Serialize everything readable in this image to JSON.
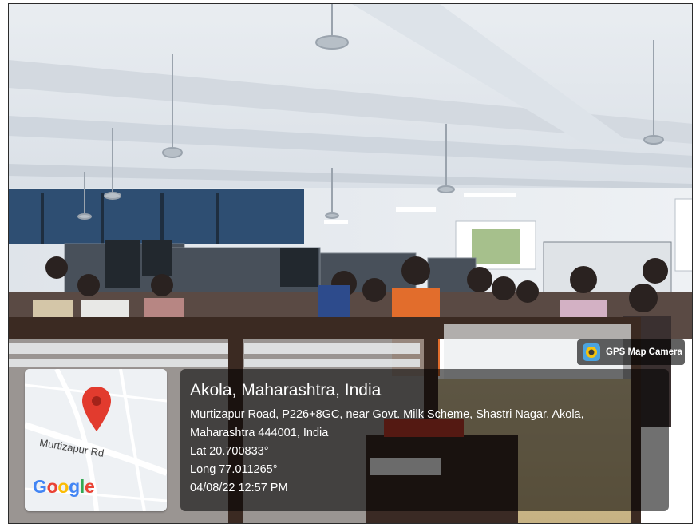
{
  "location": {
    "title": "Akola, Maharashtra, India",
    "address_line1": "Murtizapur Road, P226+8GC, near Govt. Milk Scheme, Shastri Nagar, Akola,",
    "address_line2": "Maharashtra 444001, India",
    "latitude": "Lat 20.700833°",
    "longitude": "Long 77.011265°",
    "timestamp": "04/08/22 12:57 PM"
  },
  "map": {
    "road_label": "Murtizapur Rd",
    "logo_letters": [
      {
        "ch": "G",
        "color": "#4285F4"
      },
      {
        "ch": "o",
        "color": "#EA4335"
      },
      {
        "ch": "o",
        "color": "#FBBC05"
      },
      {
        "ch": "g",
        "color": "#4285F4"
      },
      {
        "ch": "l",
        "color": "#34A853"
      },
      {
        "ch": "e",
        "color": "#EA4335"
      }
    ],
    "pin_color": "#E23B2E",
    "pin_icon": "map-pin-icon"
  },
  "badge": {
    "label": "GPS Map Camera",
    "icon": "gps-camera-icon"
  }
}
